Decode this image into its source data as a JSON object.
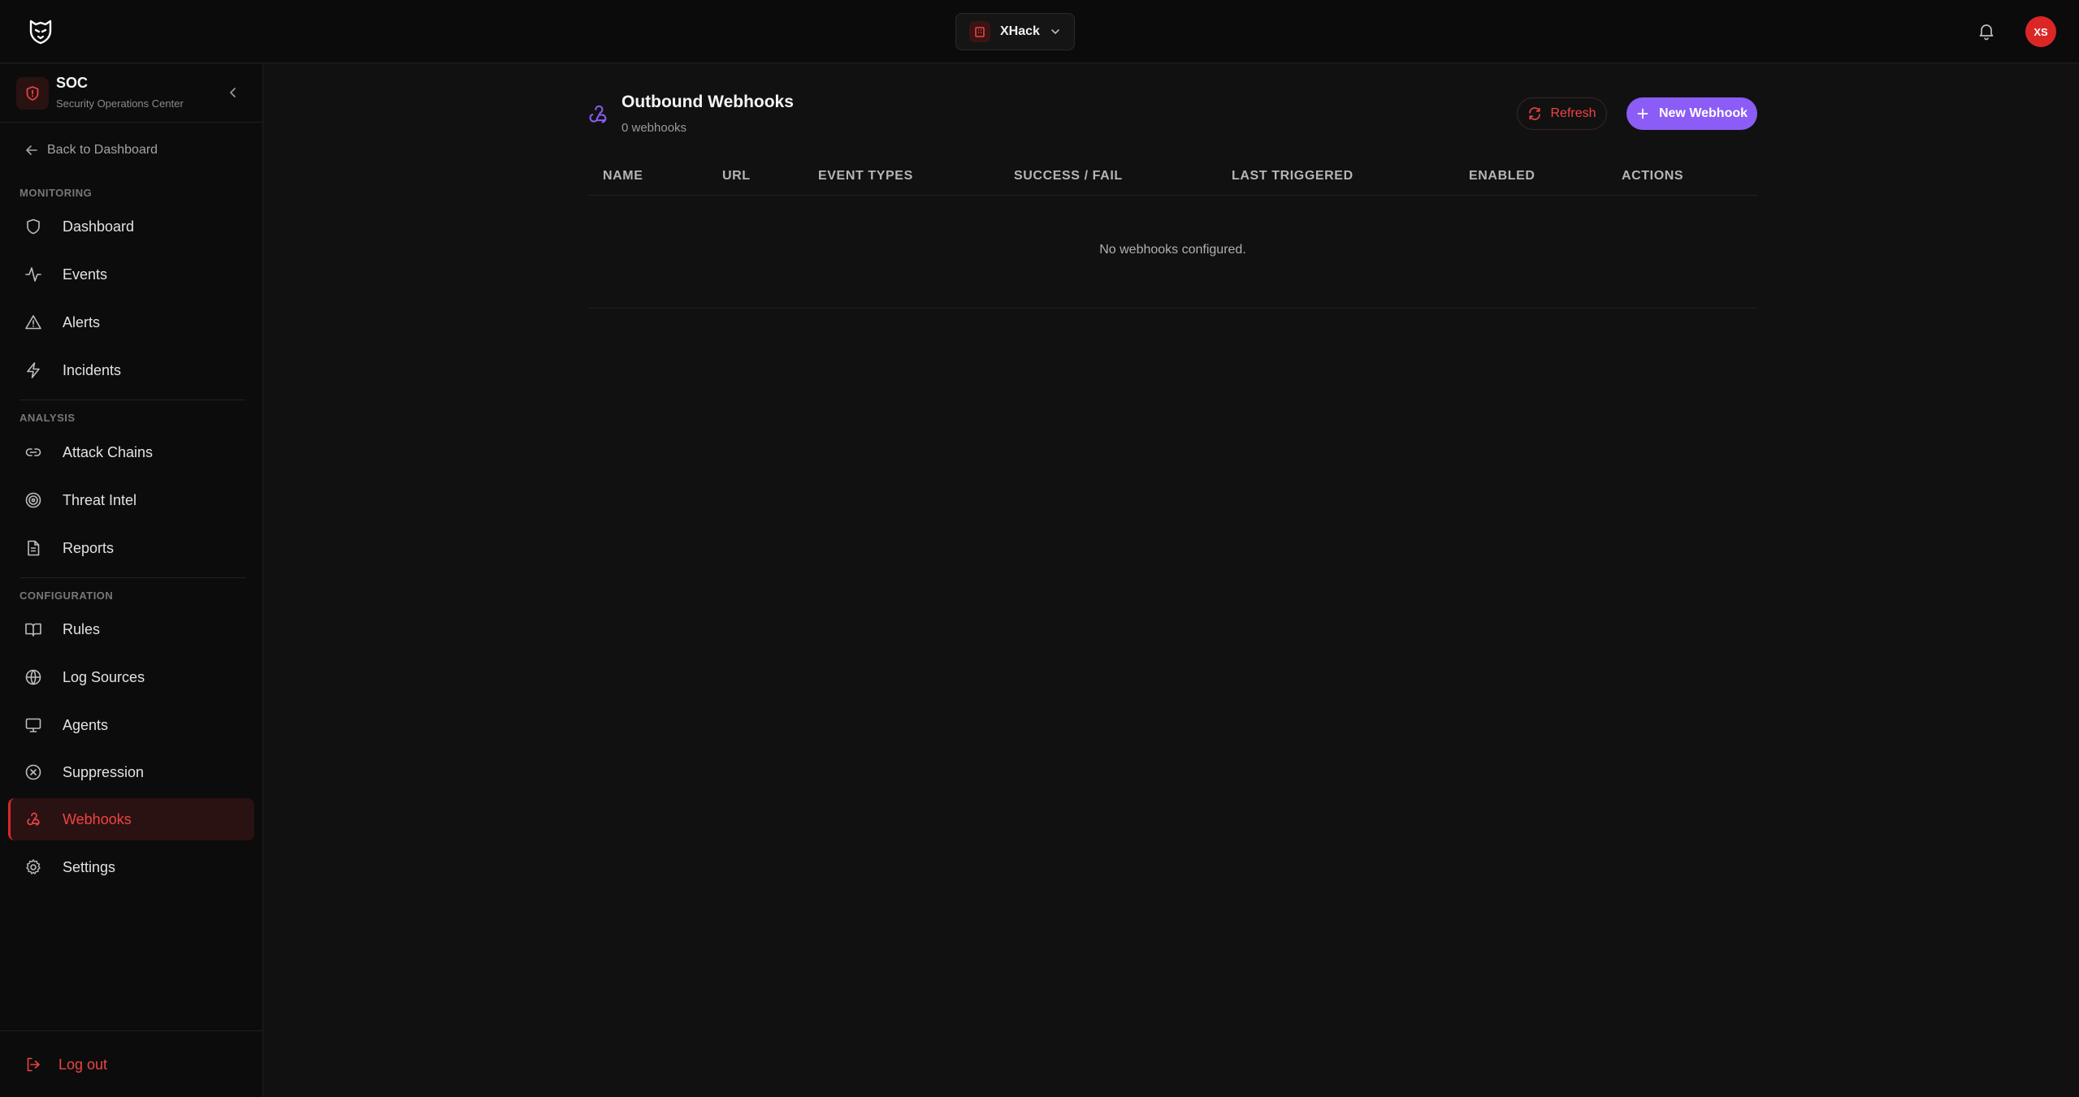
{
  "topbar": {
    "org_name": "XHack",
    "avatar_initials": "XS"
  },
  "sidebar": {
    "header_title": "SOC",
    "header_subtitle": "Security Operations Center",
    "back_label": "Back to Dashboard",
    "sections": {
      "monitoring": "MONITORING",
      "analysis": "ANALYSIS",
      "configuration": "CONFIGURATION"
    },
    "items": {
      "dashboard": "Dashboard",
      "events": "Events",
      "alerts": "Alerts",
      "incidents": "Incidents",
      "attack_chains": "Attack Chains",
      "threat_intel": "Threat Intel",
      "reports": "Reports",
      "rules": "Rules",
      "log_sources": "Log Sources",
      "agents": "Agents",
      "suppression": "Suppression",
      "webhooks": "Webhooks",
      "settings": "Settings"
    },
    "active_item": "webhooks",
    "logout_label": "Log out"
  },
  "main": {
    "title": "Outbound Webhooks",
    "count_text": "0 webhooks",
    "refresh_label": "Refresh",
    "new_label": "New Webhook",
    "table": {
      "columns": {
        "name": "NAME",
        "url": "URL",
        "event_types": "EVENT TYPES",
        "success_fail": "SUCCESS / FAIL",
        "last_triggered": "LAST TRIGGERED",
        "enabled": "ENABLED",
        "actions": "ACTIONS"
      },
      "rows": [],
      "empty_text": "No webhooks configured."
    }
  },
  "colors": {
    "accent_red": "#dc2626",
    "accent_purple": "#8b5cf6",
    "background": "#111111"
  },
  "icons": [
    "app-logo-icon",
    "building-icon",
    "chevron-down-icon",
    "bell-icon",
    "shield-alert-icon",
    "chevron-left-icon",
    "arrow-left-icon",
    "shield-icon",
    "activity-icon",
    "alert-triangle-icon",
    "zap-icon",
    "link-icon",
    "target-icon",
    "file-text-icon",
    "book-open-icon",
    "globe-icon",
    "monitor-icon",
    "x-circle-icon",
    "webhook-icon",
    "gear-icon",
    "logout-icon",
    "refresh-icon",
    "plus-icon"
  ]
}
